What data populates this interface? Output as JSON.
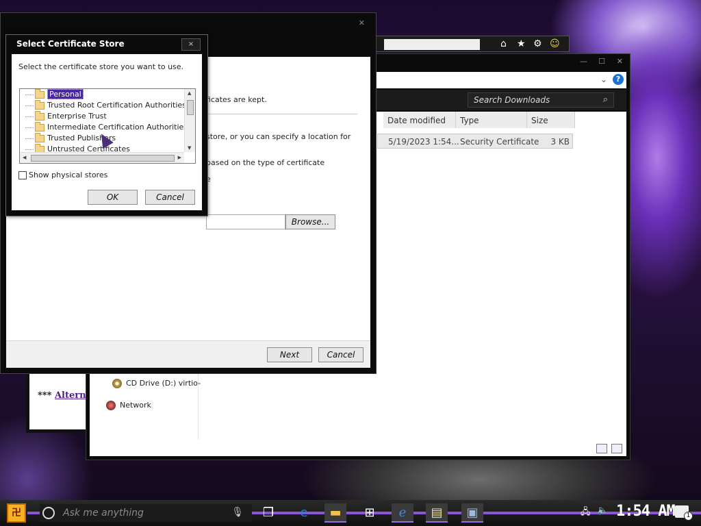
{
  "colors": {
    "accent": "#8a55d6",
    "selection": "#4a2a9a",
    "help": "#1d73d1"
  },
  "background_browser": {
    "link_prefix": "***",
    "link_text": "Altern"
  },
  "explorer": {
    "search_placeholder": "Search Downloads",
    "columns": [
      "Date modified",
      "Type",
      "Size"
    ],
    "file": {
      "date_modified": "5/19/2023 1:54...",
      "type": "Security Certificate",
      "size": "3 KB"
    },
    "nav": {
      "cd_drive": "CD Drive (D:) virtio-",
      "network": "Network"
    }
  },
  "wizard": {
    "text_1": "ficates are kept.",
    "text_2": "store, or you can specify a location for",
    "text_3": "based on the type of certificate",
    "text_4": "e",
    "browse_button": "Browse...",
    "next_button": "Next",
    "cancel_button": "Cancel"
  },
  "cert_dialog": {
    "title": "Select Certificate Store",
    "close_label": "×",
    "prompt": "Select the certificate store you want to use.",
    "stores": [
      {
        "label": "Personal",
        "selected": true
      },
      {
        "label": "Trusted Root Certification Authorities"
      },
      {
        "label": "Enterprise Trust"
      },
      {
        "label": "Intermediate Certification Authorities"
      },
      {
        "label": "Trusted Publishers"
      },
      {
        "label": "Untrusted Certificates"
      }
    ],
    "show_physical": "Show physical stores",
    "ok_button": "OK",
    "cancel_button": "Cancel"
  },
  "taskbar": {
    "search_placeholder": "Ask me anything",
    "clock": "1:54 AM"
  }
}
